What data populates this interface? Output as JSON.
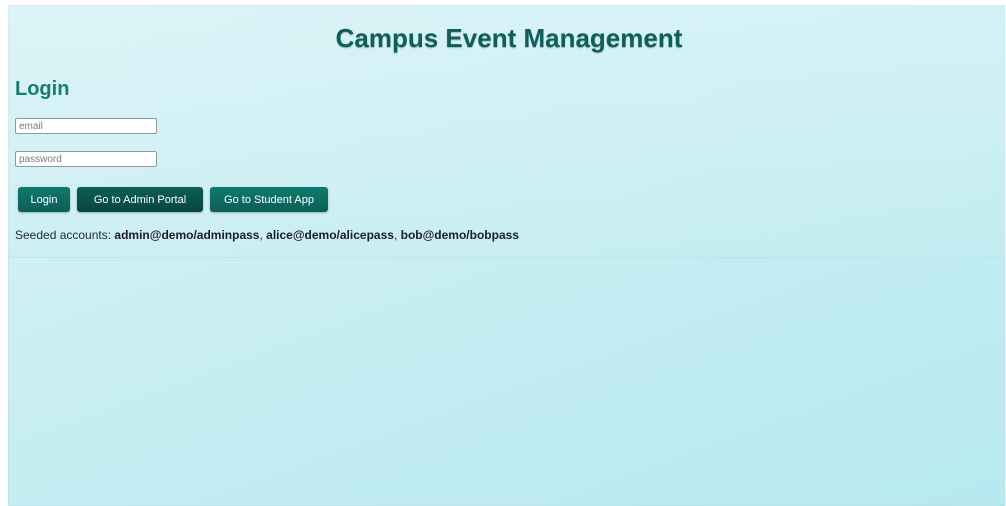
{
  "app": {
    "title": "Campus Event Management"
  },
  "login": {
    "heading": "Login",
    "email_placeholder": "email",
    "email_value": "",
    "password_placeholder": "password",
    "password_value": "",
    "buttons": {
      "login": "Login",
      "admin_portal": "Go to Admin Portal",
      "student_app": "Go to Student App"
    },
    "seeded": {
      "prefix": "Seeded accounts: ",
      "accounts": [
        "admin@demo/adminpass",
        "alice@demo/alicepass",
        "bob@demo/bobpass"
      ],
      "separator": ", "
    }
  },
  "colors": {
    "title": "#0d5f5a",
    "heading": "#167e73",
    "button": "#0f7a6e",
    "background": "#c8eef3"
  }
}
